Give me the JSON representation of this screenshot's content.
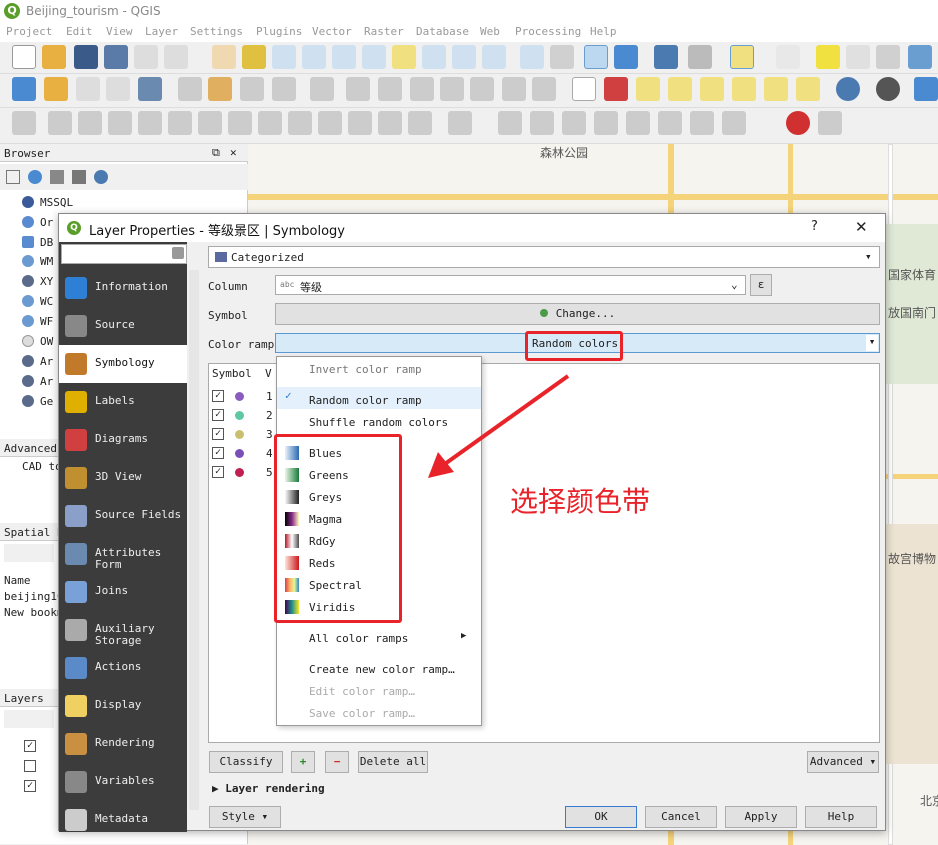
{
  "window": {
    "title": "Beijing_tourism - QGIS",
    "logo": "Q"
  },
  "menu": [
    "Project",
    "Edit",
    "View",
    "Layer",
    "Settings",
    "Plugins",
    "Vector",
    "Raster",
    "Database",
    "Web",
    "Processing",
    "Help"
  ],
  "map": {
    "labels": [
      "森林公园",
      "国家体育",
      "放国南门",
      "故宫博物",
      "北京"
    ]
  },
  "browser": {
    "title": "Browser",
    "items": [
      "MSSQL",
      "Or",
      "DB",
      "WM",
      "XY",
      "WC",
      "WF",
      "OW",
      "Ar",
      "Ar",
      "Ge"
    ],
    "advanced_title": "Advanced",
    "advanced_text": "CAD to",
    "spatial_title": "Spatial B",
    "spatial_rows": [
      "Name",
      "beijing10",
      "New bookm"
    ],
    "layers_title": "Layers"
  },
  "dialog": {
    "logo": "Q",
    "title": "Layer Properties - 等级景区 | Symbology",
    "help": "?",
    "close": "✕",
    "sidebar": [
      {
        "label": "Information",
        "icon": "info-icon",
        "color": "#2e7fd6"
      },
      {
        "label": "Source",
        "icon": "wrench-icon",
        "color": "#888888"
      },
      {
        "label": "Symbology",
        "icon": "paintbrush-icon",
        "color": "#c07a2a"
      },
      {
        "label": "Labels",
        "icon": "abc-icon",
        "color": "#e0b000"
      },
      {
        "label": "Diagrams",
        "icon": "diagram-icon",
        "color": "#d04040"
      },
      {
        "label": "3D View",
        "icon": "cube-icon",
        "color": "#c09030"
      },
      {
        "label": "Source Fields",
        "icon": "fields-icon",
        "color": "#8aa0c8"
      },
      {
        "label": "Attributes Form",
        "icon": "form-icon",
        "color": "#6a8ab0"
      },
      {
        "label": "Joins",
        "icon": "joins-icon",
        "color": "#7aa0d8"
      },
      {
        "label": "Auxiliary Storage",
        "icon": "storage-icon",
        "color": "#aaaaaa"
      },
      {
        "label": "Actions",
        "icon": "gear-icon",
        "color": "#5a8ac8"
      },
      {
        "label": "Display",
        "icon": "tooltip-icon",
        "color": "#f0d060"
      },
      {
        "label": "Rendering",
        "icon": "brush-icon",
        "color": "#c89040"
      },
      {
        "label": "Variables",
        "icon": "variables-icon",
        "color": "#888888"
      },
      {
        "label": "Metadata",
        "icon": "metadata-icon",
        "color": "#cccccc"
      }
    ],
    "renderer": "Categorized",
    "column_label": "Column",
    "column_value": "等级",
    "column_type": "abc",
    "expression_icon": "ε",
    "symbol_label": "Symbol",
    "change_button": "Change...",
    "color_ramp_label": "Color ramp",
    "color_ramp_value": "Random colors",
    "table_headers": [
      "Symbol",
      "V"
    ],
    "rows": [
      {
        "value": "1",
        "color": "#8a5cc0"
      },
      {
        "value": "2",
        "color": "#5ec8a0"
      },
      {
        "value": "3",
        "color": "#c8c070"
      },
      {
        "value": "4",
        "color": "#7a50b8"
      },
      {
        "value": "5",
        "color": "#c02050"
      }
    ],
    "classify_button": "Classify",
    "delete_all_button": "Delete all",
    "advanced_button": "Advanced",
    "layer_rendering": "Layer rendering",
    "style_button": "Style",
    "ok_button": "OK",
    "cancel_button": "Cancel",
    "apply_button": "Apply",
    "help_button": "Help"
  },
  "popup": {
    "invert": "Invert color ramp",
    "random": "Random color ramp",
    "shuffle": "Shuffle random colors",
    "ramps": [
      "Blues",
      "Greens",
      "Greys",
      "Magma",
      "RdGy",
      "Reds",
      "Spectral",
      "Viridis"
    ],
    "all_ramps": "All color ramps",
    "create": "Create new color ramp…",
    "edit": "Edit color ramp…",
    "save": "Save color ramp…"
  },
  "annotation": "选择颜色带"
}
